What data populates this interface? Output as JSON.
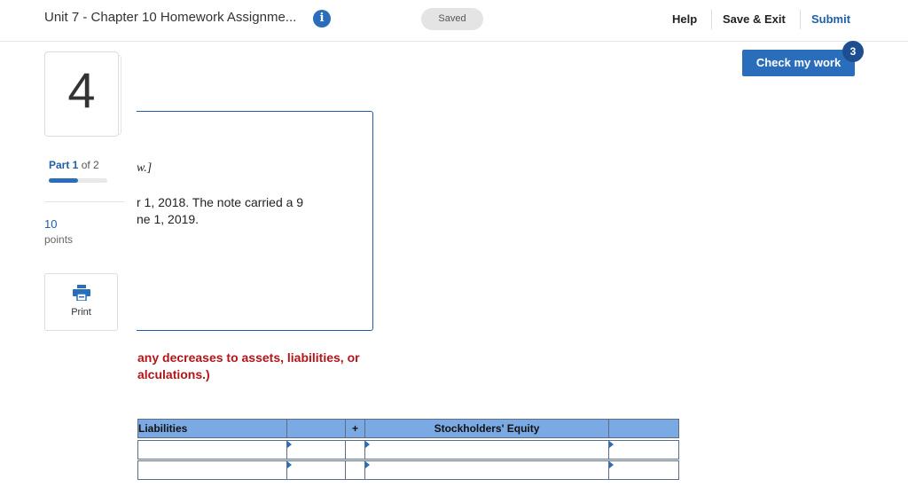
{
  "header": {
    "title": "Unit 7 - Chapter 10 Homework Assignme...",
    "info_icon": "info-icon",
    "saved_label": "Saved",
    "help_label": "Help",
    "save_exit_label": "Save & Exit",
    "submit_label": "Submit"
  },
  "check_work": {
    "label": "Check my work",
    "badge_count": "3"
  },
  "sidebar": {
    "question_number": "4",
    "part_current": "Part 1",
    "part_total": "of 2",
    "progress_fraction": 0.5,
    "points_value": "10",
    "points_label": "points",
    "print_label": "Print",
    "print_icon": "printer-icon"
  },
  "question": {
    "line1": "w.]",
    "line2": "r 1, 2018. The note carried a 9",
    "line3": "ne 1, 2019."
  },
  "instructions": {
    "line1": "any decreases to assets, liabilities, or",
    "line2": "alculations.)"
  },
  "table": {
    "headers": {
      "liabilities": "Liabilities",
      "plus": "+",
      "equity": "Stockholders' Equity"
    }
  },
  "colors": {
    "accent": "#2a6ebb",
    "badge": "#1d4e8f",
    "instruction_red": "#b3151a",
    "table_header": "#7ba9e3"
  }
}
